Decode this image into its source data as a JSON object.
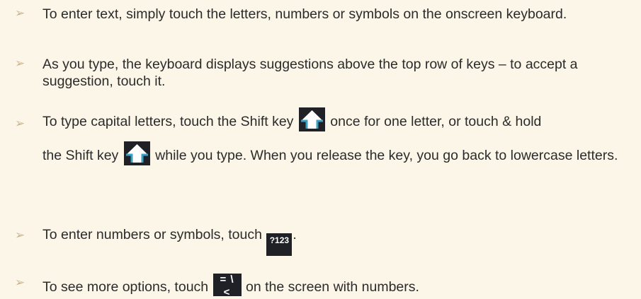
{
  "bullet_icon": "arrow-bullet-icon",
  "items": [
    {
      "text": "To enter text, simply touch the letters, numbers or symbols on the onscreen keyboard."
    },
    {
      "text": "As you type, the keyboard displays suggestions above the top row of keys – to accept a suggestion, touch it."
    },
    {
      "part1": "To type capital letters, touch the Shift key",
      "part2": "once for one letter, or touch & hold",
      "part3": "the Shift key",
      "part4": "while you type. When you release the key, you go back to lowercase letters.",
      "icon": "shift-key-icon"
    },
    {
      "part1": "To enter numbers or symbols, touch",
      "key_label": "?123",
      "part2": "."
    },
    {
      "part1": "To see more options, touch",
      "key_label": "= \\ <",
      "part2": "on the screen with numbers."
    }
  ]
}
